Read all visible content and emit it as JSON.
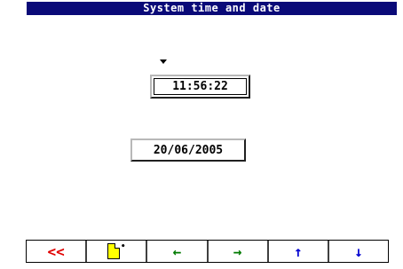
{
  "window": {
    "title": "System time and date"
  },
  "time_field": {
    "value": "11:56:22"
  },
  "date_field": {
    "value": "20/06/2005"
  },
  "toolbar": {
    "buttons": [
      {
        "name": "back",
        "label": "<<",
        "color": "#e00000"
      },
      {
        "name": "new-document",
        "icon": "document-icon"
      },
      {
        "name": "left",
        "label": "←",
        "color": "#007a00"
      },
      {
        "name": "right",
        "label": "→",
        "color": "#007a00"
      },
      {
        "name": "up",
        "label": "↑",
        "color": "#0000d0"
      },
      {
        "name": "down",
        "label": "↓",
        "color": "#0000d0"
      }
    ]
  }
}
